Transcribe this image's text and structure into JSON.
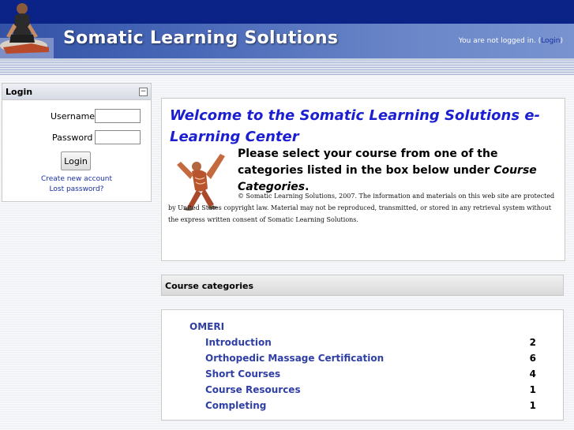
{
  "header": {
    "site_title": "Somatic Learning Solutions",
    "login_status_prefix": "You are not logged in. (",
    "login_link": "Login",
    "login_status_suffix": ")",
    "colors": {
      "topbar": "#0b2387",
      "banner": "#4a69b8"
    }
  },
  "login_block": {
    "title": "Login",
    "toggle_icon": "minus-icon",
    "username_label": "Username",
    "username_value": "",
    "password_label": "Password",
    "password_value": "",
    "login_button": "Login",
    "create_account": "Create new account",
    "lost_password": "Lost password?"
  },
  "welcome": {
    "heading": "Welcome to the Somatic Learning Solutions e-Learning Center",
    "instruction_prefix": "Please select your course from one of the categories listed in the box below under ",
    "instruction_em": "Course Categories",
    "instruction_suffix": ".",
    "copyright": "© Somatic Learning Solutions, 2007. The information and materials on this web site are protected by United States copyright law. Material may not be reproduced, transmitted, or stored in any retrieval system without the express written consent of Somatic Learning Solutions.",
    "image": "anatomy-figure"
  },
  "course_categories": {
    "title": "Course categories",
    "category": "OMERI",
    "courses": [
      {
        "name": "Introduction",
        "count": "2"
      },
      {
        "name": "Orthopedic Massage Certification",
        "count": "6"
      },
      {
        "name": "Short Courses",
        "count": "4"
      },
      {
        "name": "Course Resources",
        "count": "1"
      },
      {
        "name": "Completing",
        "count": "1"
      }
    ]
  }
}
